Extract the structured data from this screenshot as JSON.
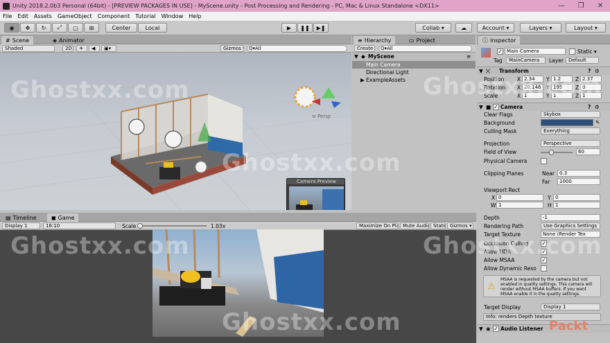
{
  "window": {
    "title": "Unity 2018.2.0b3 Personal (64bit) - [PREVIEW PACKAGES IN USE] - MyScene.unity - Post Processing and Rendering - PC, Mac & Linux Standalone <DX11>",
    "min": "—",
    "max": "❐",
    "close": "✕"
  },
  "menu": [
    "File",
    "Edit",
    "Assets",
    "GameObject",
    "Component",
    "Tutorial",
    "Window",
    "Help"
  ],
  "toolbar": {
    "center": "Center",
    "local": "Local",
    "play": "▶",
    "pause": "❚❚",
    "step": "▶❚",
    "collab": "Collab ▾",
    "account": "Account ▾",
    "layers": "Layers ▾",
    "layout": "Layout ▾"
  },
  "scene": {
    "tab_scene": "Scene",
    "tab_animator": "Animator",
    "shaded": "Shaded",
    "mode2d": "2D",
    "gizmos": "Gizmos ▾",
    "search": "Q▾All",
    "persp": "≡ Persp",
    "camera_preview": "Camera Preview"
  },
  "game": {
    "tab_timeline": "Timeline",
    "tab_game": "Game",
    "display": "Display 1",
    "aspect": "16:10",
    "scale_label": "Scale",
    "scale_value": "1.03x",
    "maximize": "Maximize On Play",
    "mute": "Mute Audio",
    "stats": "Stats",
    "gizmos": "Gizmos ▾"
  },
  "hierarchy": {
    "tab": "Hierarchy",
    "tab2": "Project",
    "create": "Create ▾",
    "search": "Q▾All",
    "scene": "MyScene",
    "items": [
      "Main Camera",
      "Directional Light",
      "ExampleAssets"
    ]
  },
  "inspector": {
    "tab": "Inspector",
    "object": "Main Camera",
    "static": "Static ▾",
    "tag_label": "Tag",
    "tag": "MainCamera",
    "layer_label": "Layer",
    "layer": "Default",
    "transform": {
      "title": "Transform",
      "pos_label": "Position",
      "rot_label": "Rotation",
      "scale_label": "Scale",
      "pos": [
        "2.34",
        "1.2",
        "2.37"
      ],
      "rot": [
        "20.146",
        "195",
        "0"
      ],
      "scale": [
        "1",
        "1",
        "1"
      ]
    },
    "camera": {
      "title": "Camera",
      "clear_flags_label": "Clear Flags",
      "clear_flags": "Skybox",
      "background_label": "Background",
      "background_color": "#2f4e7a",
      "culling_label": "Culling Mask",
      "culling": "Everything",
      "projection_label": "Projection",
      "projection": "Perspective",
      "fov_label": "Field of View",
      "fov": "60",
      "fov_level": 0.33,
      "physical_label": "Physical Camera",
      "clipping_label": "Clipping Planes",
      "near_label": "Near",
      "near": "0.3",
      "far_label": "Far",
      "far": "1000",
      "viewport_label": "Viewport Rect",
      "vx": "0",
      "vy": "0",
      "vw": "1",
      "vh": "1",
      "depth_label": "Depth",
      "depth": "-1",
      "render_path_label": "Rendering Path",
      "render_path": "Use Graphics Settings",
      "target_tex_label": "Target Texture",
      "target_tex": "None (Render Tex",
      "occlusion_label": "Occlusion Culling",
      "hdr_label": "Allow HDR",
      "msaa_label": "Allow MSAA",
      "dynres_label": "Allow Dynamic Reso",
      "warning": "MSAA is requested by the camera but not enabled in quality settings. This camera will render without MSAA buffers. If you want MSAA enable it in the quality settings.",
      "target_display_label": "Target Display",
      "target_display": "Display 1",
      "info": "Info: renders Depth texture"
    },
    "audio_listener": "Audio Listener"
  },
  "watermark": "Ghostxx.com",
  "brand": "Packt"
}
